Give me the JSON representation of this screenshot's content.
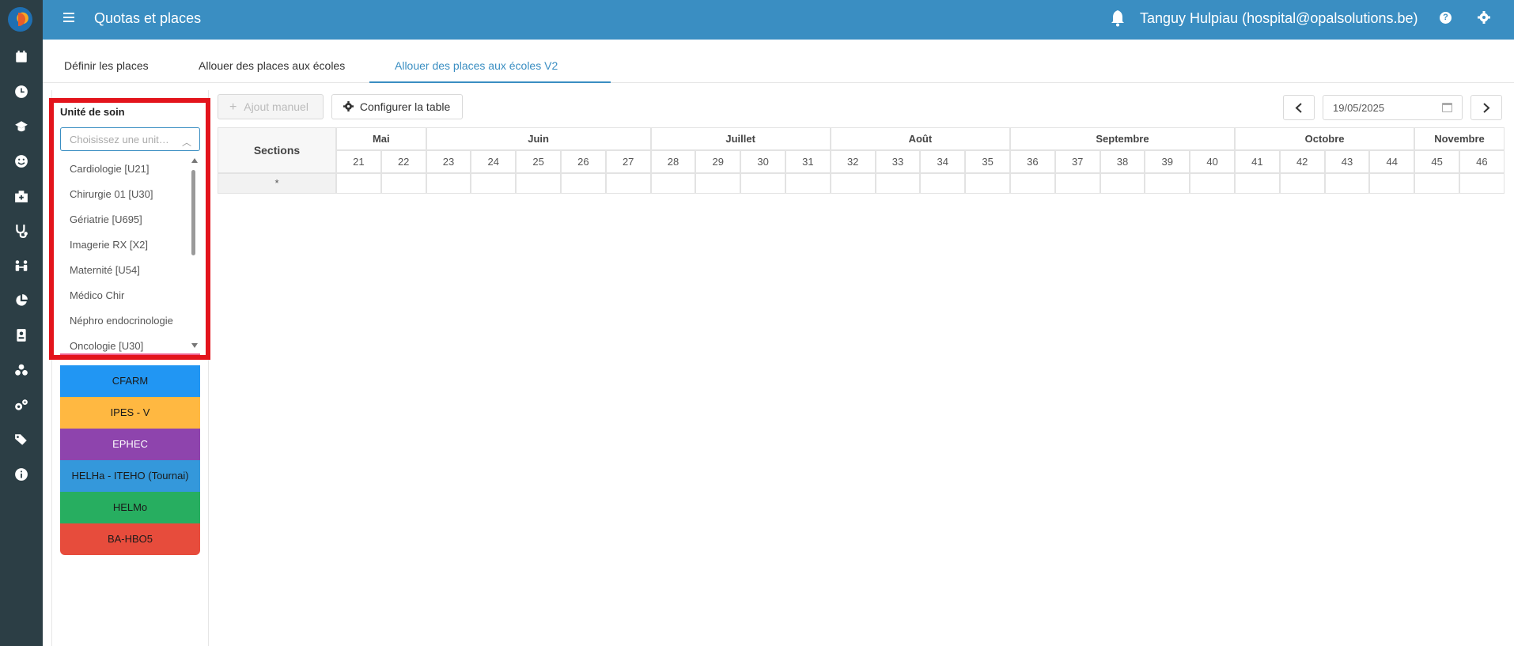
{
  "app": {
    "title": "Quotas et places"
  },
  "user": {
    "name": "Tanguy Hulpiau (hospital@opalsolutions.be)"
  },
  "tabs": [
    {
      "label": "Définir les places"
    },
    {
      "label": "Allouer des places aux écoles"
    },
    {
      "label": "Allouer des places aux écoles V2",
      "active": true
    }
  ],
  "toolbar": {
    "manual_add": "Ajout manuel",
    "configure": "Configurer la table",
    "date": "19/05/2025"
  },
  "unit_select": {
    "label": "Unité de soin",
    "placeholder": "Choisissez une unité de soin",
    "options": [
      "Cardiologie [U21]",
      "Chirurgie 01 [U30]",
      "Gériatrie [U695]",
      "Imagerie RX [X2]",
      "Maternité [U54]",
      "Médico Chir",
      "Néphro endocrinologie",
      "Oncologie [U30]"
    ]
  },
  "schools": [
    {
      "label": "CFARM",
      "color": "#2196f3",
      "text_color": "#1a1a1a"
    },
    {
      "label": "IPES - V",
      "color": "#ffb841",
      "text_color": "#1a1a1a"
    },
    {
      "label": "EPHEC",
      "color": "#8e44ad",
      "text_color": "#ffffff"
    },
    {
      "label": "HELHa - ITEHO (Tournai)",
      "color": "#3498db",
      "text_color": "#1a1a1a"
    },
    {
      "label": "HELMo",
      "color": "#27ae60",
      "text_color": "#1a1a1a"
    },
    {
      "label": "BA-HBO5",
      "color": "#e74c3c",
      "text_color": "#1a1a1a"
    }
  ],
  "grid": {
    "sections_header": "Sections",
    "row_label": "*",
    "months": [
      {
        "name": "Mai",
        "weeks": 2
      },
      {
        "name": "Juin",
        "weeks": 5
      },
      {
        "name": "Juillet",
        "weeks": 4
      },
      {
        "name": "Août",
        "weeks": 4
      },
      {
        "name": "Septembre",
        "weeks": 5
      },
      {
        "name": "Octobre",
        "weeks": 4
      },
      {
        "name": "Novembre",
        "weeks": 2
      }
    ],
    "weeks": [
      "21",
      "22",
      "23",
      "24",
      "25",
      "26",
      "27",
      "28",
      "29",
      "30",
      "31",
      "32",
      "33",
      "34",
      "35",
      "36",
      "37",
      "38",
      "39",
      "40",
      "41",
      "42",
      "43",
      "44",
      "45",
      "46"
    ]
  },
  "colors": {
    "topbar": "#3a8ec2",
    "nav": "#2c3e45",
    "accent": "#3a8ec2",
    "highlight": "#e3141c"
  }
}
